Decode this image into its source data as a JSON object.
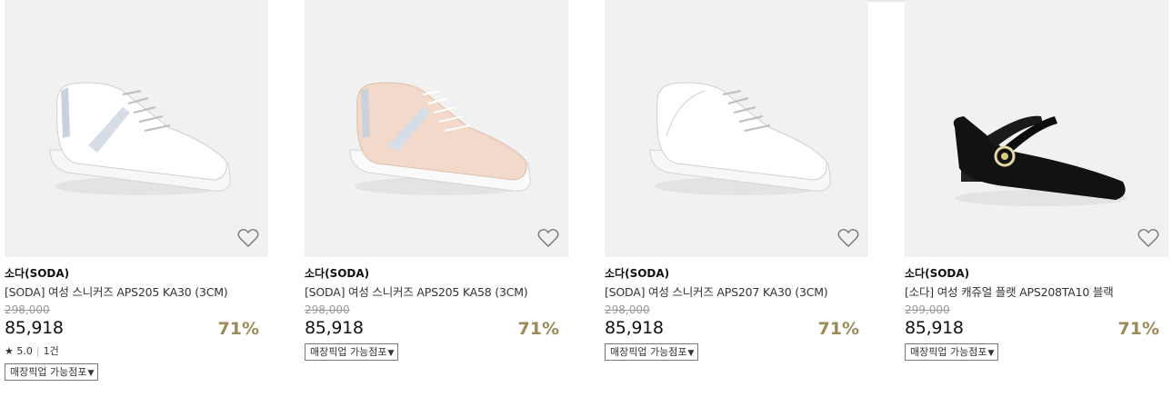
{
  "products": [
    {
      "brand": "소다(SODA)",
      "name": "[SODA] 여성 스니커즈 APS205 KA30 (3CM)",
      "original_price": "298,000",
      "price": "85,918",
      "discount": "71%",
      "rating": {
        "score": "5.0",
        "count": "1건"
      },
      "pickup_label": "매장픽업 가능점포",
      "image": "white-sneaker-silver-stripe",
      "wishlist_icon": "heart-outline-icon"
    },
    {
      "brand": "소다(SODA)",
      "name": "[SODA] 여성 스니커즈 APS205 KA58 (3CM)",
      "original_price": "298,000",
      "price": "85,918",
      "discount": "71%",
      "pickup_label": "매장픽업 가능점포",
      "image": "pink-sneaker-silver-stripe",
      "wishlist_icon": "heart-outline-icon"
    },
    {
      "brand": "소다(SODA)",
      "name": "[SODA] 여성 스니커즈 APS207 KA30 (3CM)",
      "original_price": "298,000",
      "price": "85,918",
      "discount": "71%",
      "pickup_label": "매장픽업 가능점포",
      "image": "white-sneaker",
      "wishlist_icon": "heart-outline-icon"
    },
    {
      "brand": "소다(SODA)",
      "name": "[소다] 여성 캐쥬얼 플랫 APS208TA10 블랙",
      "original_price": "299,000",
      "price": "85,918",
      "discount": "71%",
      "pickup_label": "매장픽업 가능점포",
      "image": "black-mary-jane-flat",
      "wishlist_icon": "heart-outline-icon"
    }
  ],
  "colors": {
    "discount": "#9a8b5a",
    "image_bg": "#f1f1f1",
    "muted": "#999999"
  }
}
